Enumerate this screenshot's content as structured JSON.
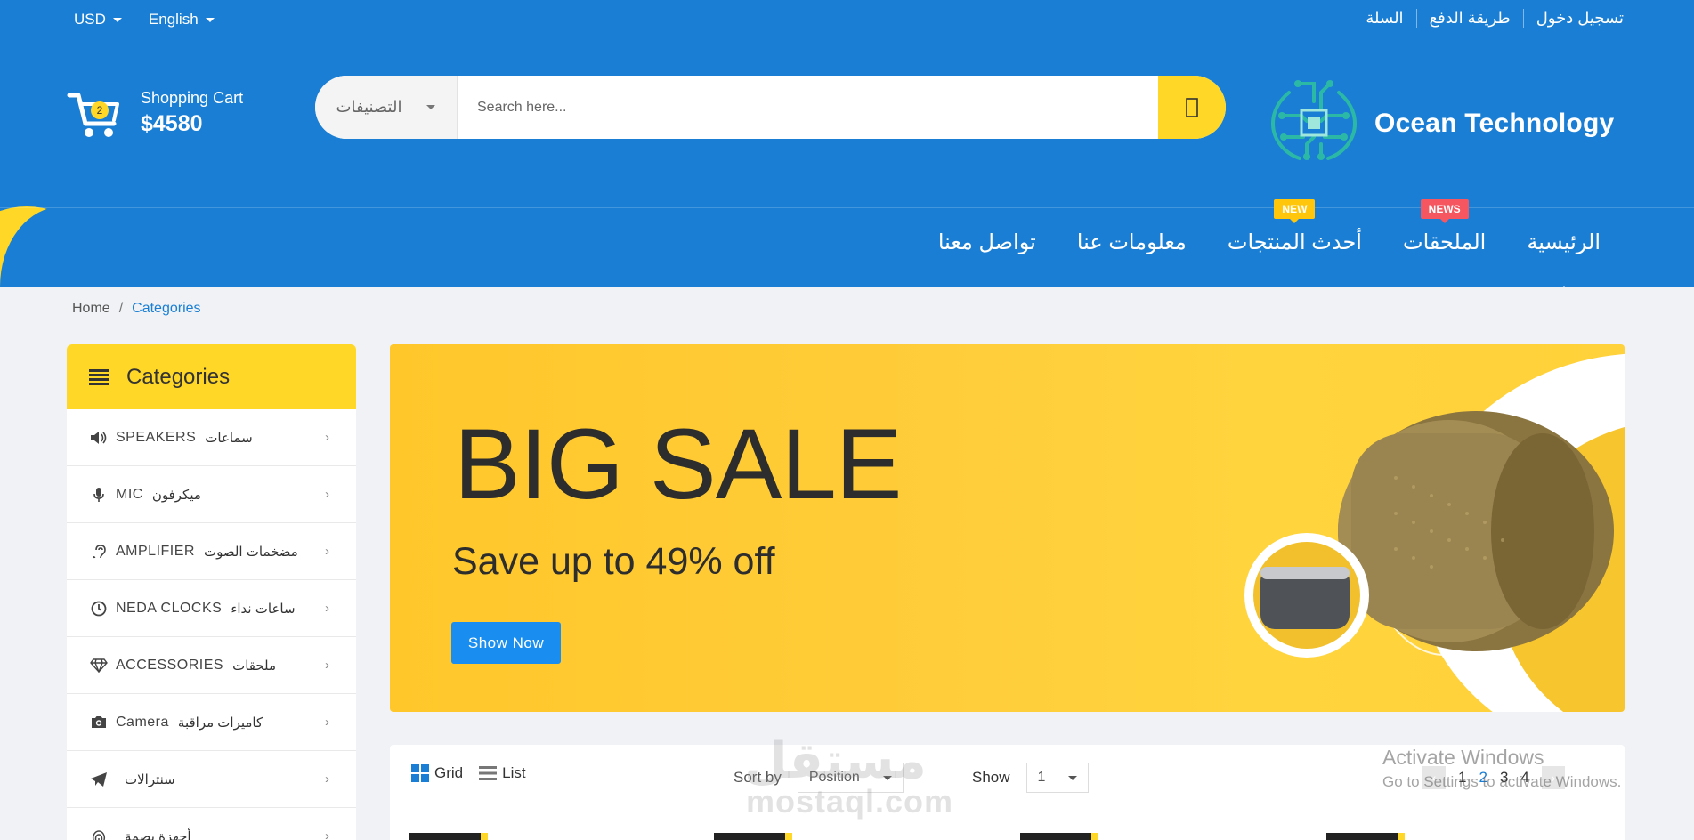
{
  "topbar": {
    "currency": "USD",
    "language": "English",
    "links": [
      "تسجيل دخول",
      "طريقة الدفع",
      "السلة"
    ]
  },
  "cart": {
    "count": "2",
    "label": "Shopping Cart",
    "total": "$4580"
  },
  "search": {
    "category": "التصنيفات",
    "placeholder": "Search here..."
  },
  "logo": {
    "text": "Ocean Technology"
  },
  "nav": {
    "items": [
      {
        "label": "الرئيسية",
        "tag": ""
      },
      {
        "label": "الملحقات",
        "tag": "NEWS"
      },
      {
        "label": "أحدث المنتجات",
        "tag": "NEW"
      },
      {
        "label": "معلومات عنا",
        "tag": ""
      },
      {
        "label": "تواصل معنا",
        "tag": ""
      }
    ]
  },
  "breadcrumb": {
    "home": "Home",
    "sep": "/",
    "current": "Categories"
  },
  "sidebar": {
    "title": "Categories",
    "items": [
      {
        "en": "SPEAKERS",
        "ar": "سماعات",
        "icon": "speaker-icon"
      },
      {
        "en": "MIC",
        "ar": "ميكرفون",
        "icon": "mic-icon"
      },
      {
        "en": "AMPLIFIER",
        "ar": "مضخمات الصوت",
        "icon": "hearing-icon"
      },
      {
        "en": "NEDA CLOCKS",
        "ar": "ساعات نداء",
        "icon": "clock-icon"
      },
      {
        "en": "ACCESSORIES",
        "ar": "ملحقات",
        "icon": "diamond-icon"
      },
      {
        "en": "Camera",
        "ar": "كاميرات مراقبة",
        "icon": "camera-icon"
      },
      {
        "en": "",
        "ar": "سنترالات",
        "icon": "send-icon"
      },
      {
        "en": "",
        "ar": "أجهزة بصمة",
        "icon": "fingerprint-icon"
      }
    ]
  },
  "banner": {
    "title": "BIG SALE",
    "subtitle": "Save up to 49% off",
    "button": "Show Now"
  },
  "toolbar": {
    "grid": "Grid",
    "list": "List",
    "sort_label": "Sort by",
    "sort_value": "Position",
    "show_label": "Show",
    "show_value": "1",
    "pages": [
      "1",
      "2",
      "3",
      "4"
    ],
    "current_page": "2"
  },
  "watermark": {
    "arabic": "مستقل",
    "site": "mostaql.com"
  },
  "os_notice": {
    "title": "Activate Windows",
    "subtitle": "Go to Settings to activate Windows."
  },
  "colors": {
    "primary": "#1a7fd4",
    "accent": "#ffd726",
    "news": "#f65660",
    "new": "#ffc60b"
  }
}
